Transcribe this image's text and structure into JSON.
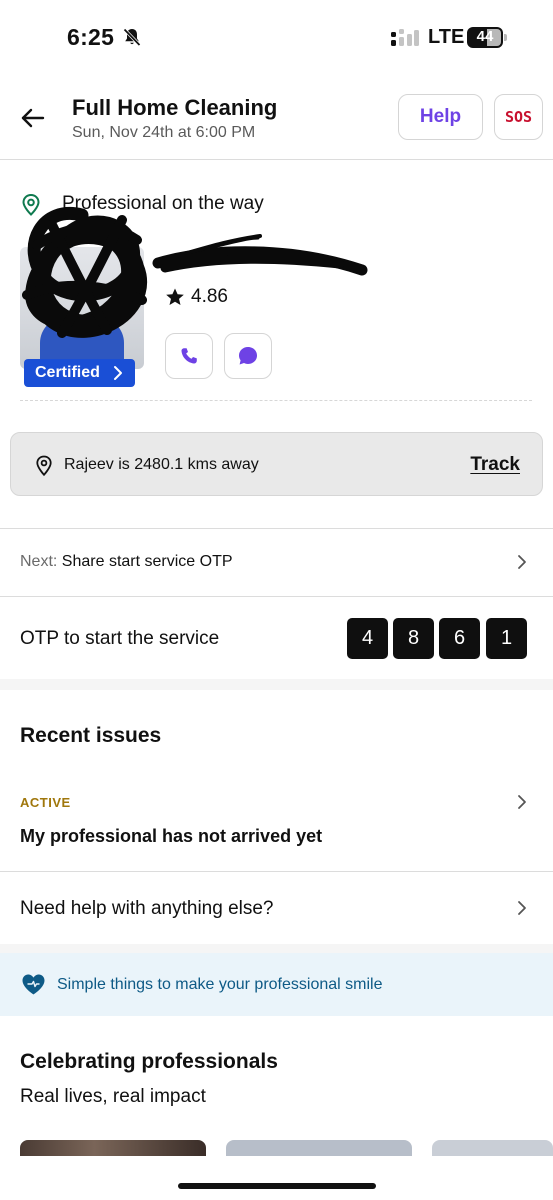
{
  "status_bar": {
    "time": "6:25",
    "network": "LTE",
    "battery": "44",
    "icons": [
      "bell-slash-icon",
      "signal-icon"
    ]
  },
  "header": {
    "title": "Full Home Cleaning",
    "subtitle": "Sun, Nov 24th at 6:00 PM",
    "help_label": "Help",
    "sos_label": "SOS",
    "icons": [
      "back-arrow-icon"
    ]
  },
  "professional": {
    "status": "Professional on the way",
    "rating": "4.86",
    "certified_label": "Certified",
    "icons": [
      "location-pin-icon",
      "star-icon",
      "phone-icon",
      "chat-icon",
      "chevron-right-icon"
    ]
  },
  "distance": {
    "text": "Rajeev is 2480.1 kms away",
    "track_label": "Track"
  },
  "next_step": {
    "prefix": "Next:",
    "text": "Share start service OTP"
  },
  "otp": {
    "label": "OTP to start the service",
    "digits": [
      "4",
      "8",
      "6",
      "1"
    ]
  },
  "recent_issues": {
    "title": "Recent issues",
    "items": [
      {
        "status": "ACTIVE",
        "title": "My professional has not arrived yet"
      }
    ],
    "help_text": "Need help with anything else?"
  },
  "smile_banner": {
    "text": "Simple things to make your professional smile",
    "icon": "heart-icon"
  },
  "celebrating": {
    "title": "Celebrating professionals",
    "subtitle": "Real lives, real impact"
  },
  "colors": {
    "brand_purple": "#6e42e5",
    "sos_red": "#c8102e",
    "certified_blue": "#1a4fd6",
    "active_amber": "#a0770c",
    "banner_text": "#0e5a86",
    "location_green": "#0f7a4f"
  }
}
